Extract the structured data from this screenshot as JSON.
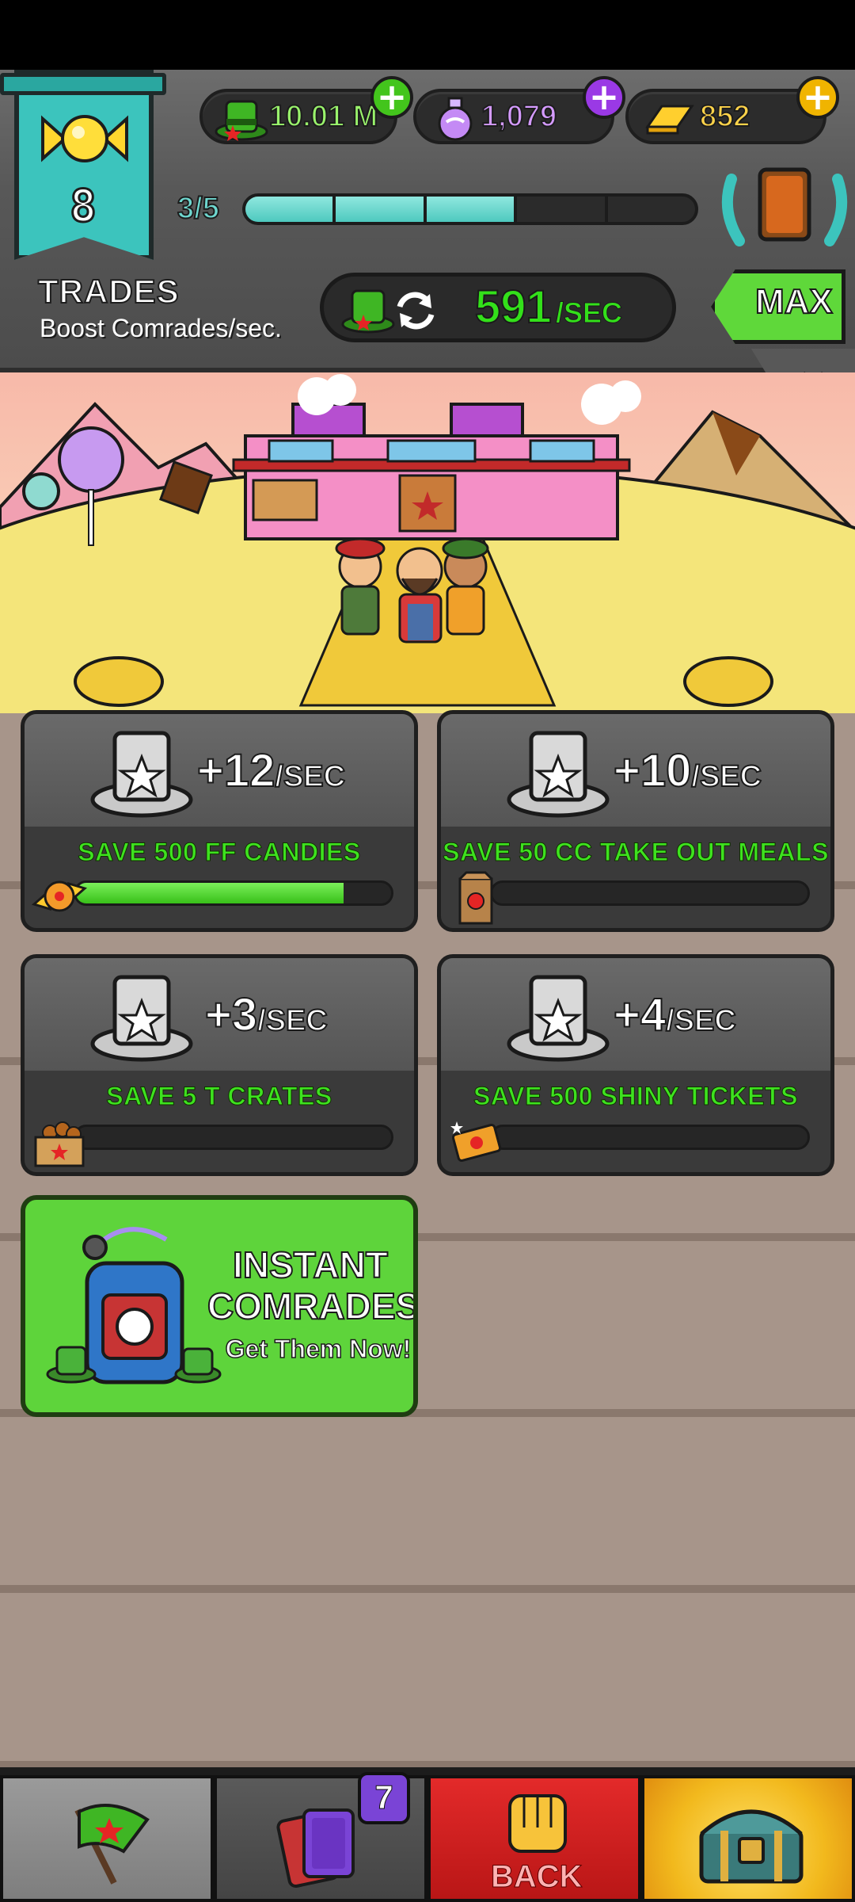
{
  "level": {
    "number": "8",
    "progress_text": "3/5",
    "progress_fraction": 0.6
  },
  "currencies": [
    {
      "name": "hats",
      "icon": "green-hat-icon",
      "value": "10.01 M",
      "color": "#9af36c",
      "plus_color": "#43c51c"
    },
    {
      "name": "potions",
      "icon": "potion-icon",
      "value": "1,079",
      "color": "#d59bff",
      "plus_color": "#9a39e5"
    },
    {
      "name": "gold",
      "icon": "gold-bar-icon",
      "value": "852",
      "color": "#ffd34a",
      "plus_color": "#f0b400"
    }
  ],
  "trades": {
    "title": "TRADES",
    "subtitle": "Boost Comrades/sec.",
    "rate_value": "591",
    "rate_unit": "/SEC",
    "max_label": "MAX"
  },
  "cards": [
    {
      "rate": "+12",
      "unit": "/SEC",
      "goal": "SAVE 500 FF CANDIES",
      "icon": "candy-icon",
      "progress": 0.85
    },
    {
      "rate": "+10",
      "unit": "/SEC",
      "goal": "SAVE 50 CC TAKE OUT MEALS",
      "icon": "takeout-bag-icon",
      "progress": 0
    },
    {
      "rate": "+3",
      "unit": "/SEC",
      "goal": "SAVE 5 T CRATES",
      "icon": "crate-icon",
      "progress": 0
    },
    {
      "rate": "+4",
      "unit": "/SEC",
      "goal": "SAVE 500 SHINY TICKETS",
      "icon": "ticket-icon",
      "progress": 0
    }
  ],
  "ad": {
    "title_line1": "INSTANT",
    "title_line2": "COMRADES!",
    "cta": "Get Them Now!"
  },
  "bottom_nav": {
    "cards_badge": "7",
    "back_label": "BACK"
  },
  "colors": {
    "accent_green": "#33e01a",
    "teal": "#3cc4bd",
    "red": "#e32a2a"
  }
}
